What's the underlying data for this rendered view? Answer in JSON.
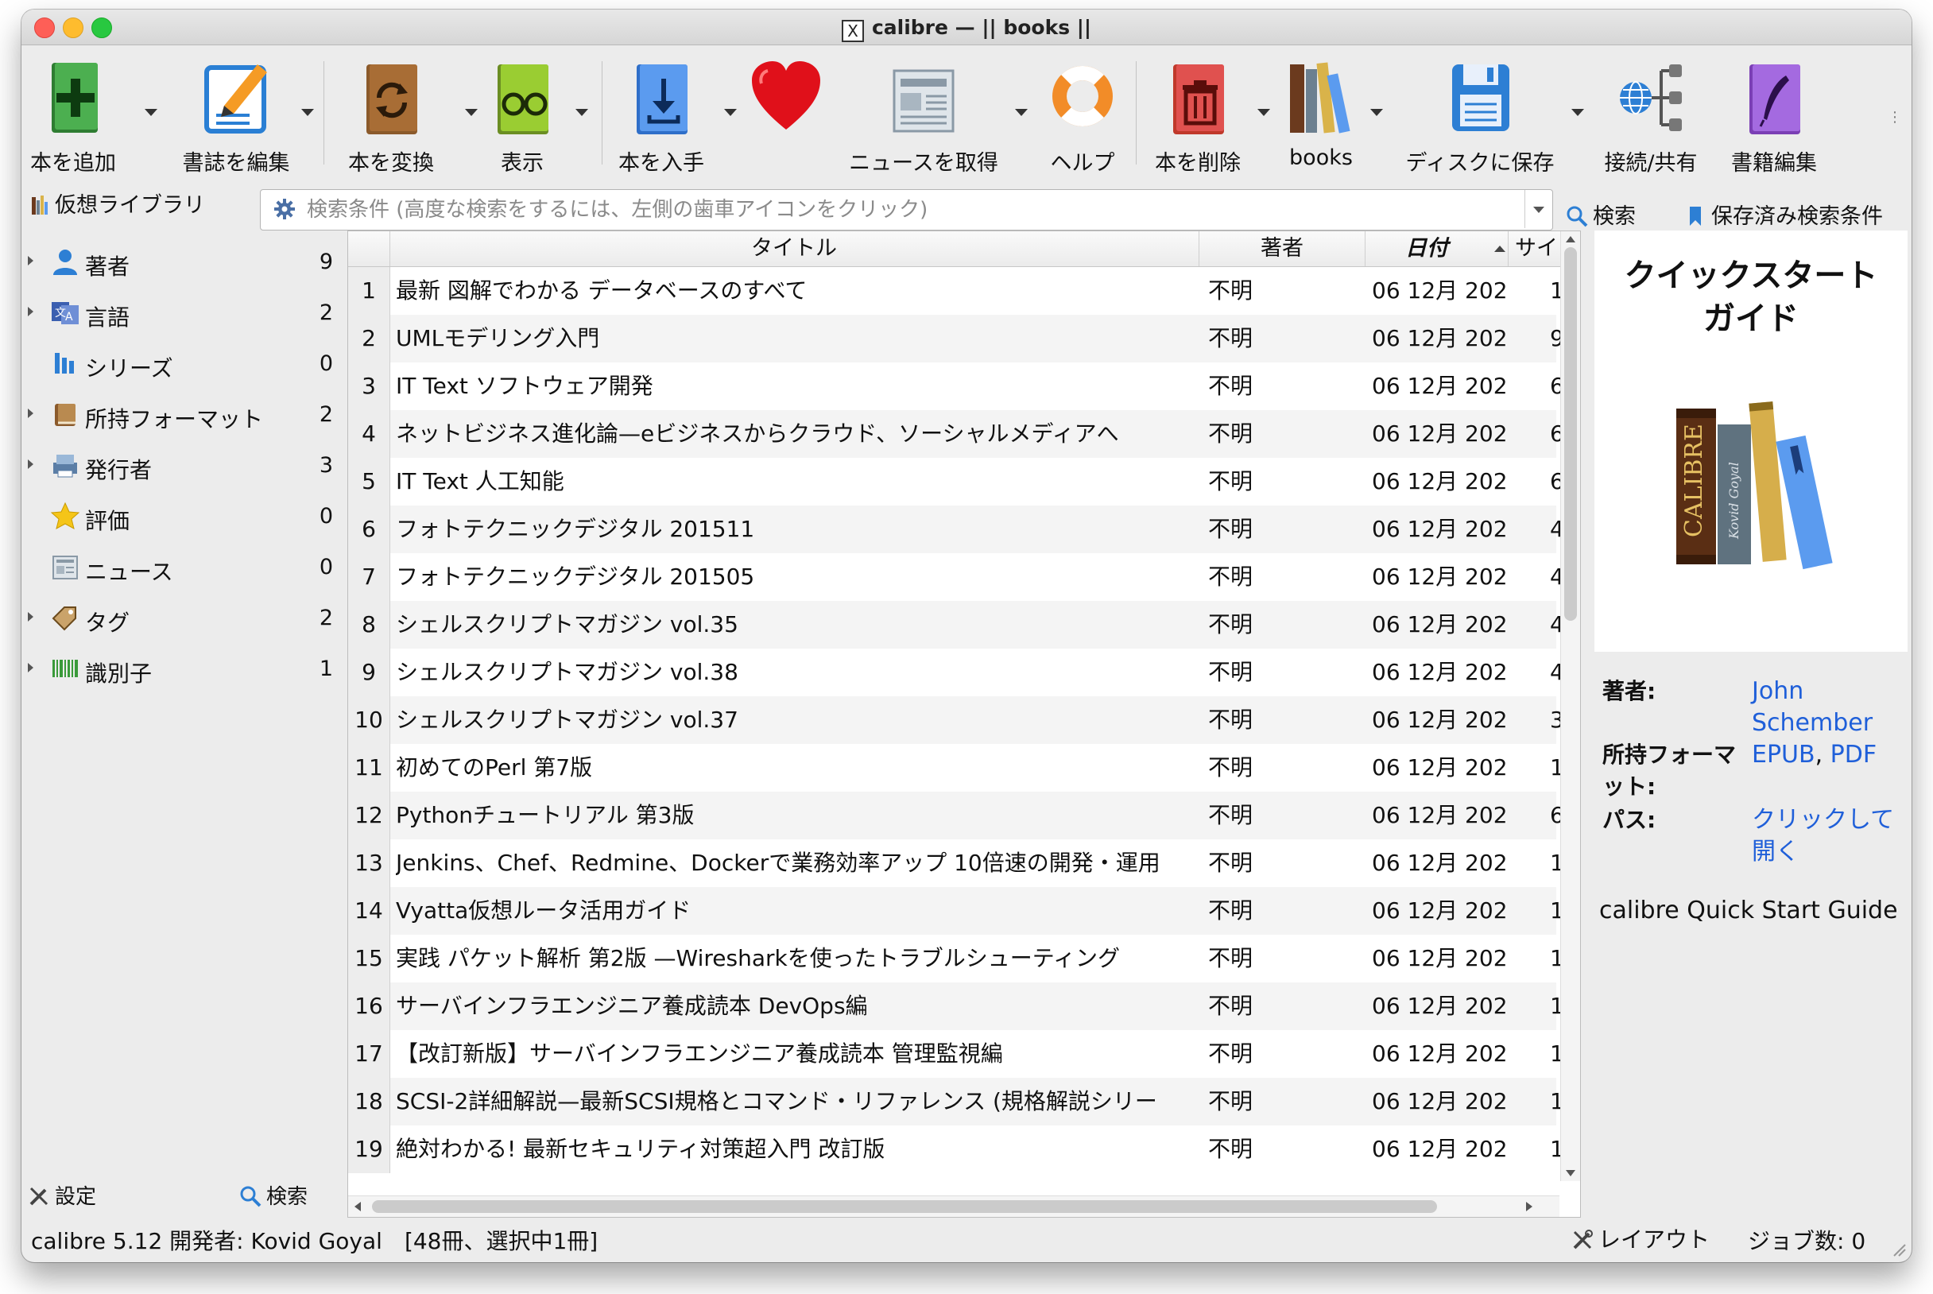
{
  "window": {
    "title": "calibre — || books ||"
  },
  "toolbar": {
    "add_book": "本を追加",
    "edit_metadata": "書誌を編集",
    "convert": "本を変換",
    "view": "表示",
    "get_books": "本を入手",
    "fetch_news": "ニュースを取得",
    "help": "ヘルプ",
    "remove": "本を削除",
    "library": "books",
    "save_to_disk": "ディスクに保存",
    "connect_share": "接続/共有",
    "edit_book": "書籍編集"
  },
  "search": {
    "virtual_library": "仮想ライブラリ",
    "placeholder": "検索条件 (高度な検索をするには、左側の歯車アイコンをクリック)",
    "search_button": "検索",
    "saved_searches": "保存済み検索条件"
  },
  "tag_browser": {
    "items": [
      {
        "label": "著者",
        "count": "9",
        "icon": "person-icon"
      },
      {
        "label": "言語",
        "count": "2",
        "icon": "language-icon"
      },
      {
        "label": "シリーズ",
        "count": "0",
        "icon": "series-icon"
      },
      {
        "label": "所持フォーマット",
        "count": "2",
        "icon": "format-book-icon"
      },
      {
        "label": "発行者",
        "count": "3",
        "icon": "publisher-icon"
      },
      {
        "label": "評価",
        "count": "0",
        "icon": "star-icon"
      },
      {
        "label": "ニュース",
        "count": "0",
        "icon": "news-icon"
      },
      {
        "label": "タグ",
        "count": "2",
        "icon": "tag-icon"
      },
      {
        "label": "識別子",
        "count": "1",
        "icon": "barcode-icon"
      }
    ],
    "settings": "設定",
    "find": "検索"
  },
  "book_list": {
    "columns": {
      "title": "タイトル",
      "author": "著者",
      "date": "日付",
      "size": "サイ"
    },
    "rows": [
      {
        "n": "1",
        "title": "最新 図解でわかる データベースのすべて",
        "author": "不明",
        "date": "06 12月 202",
        "size": "1"
      },
      {
        "n": "2",
        "title": "UMLモデリング入門",
        "author": "不明",
        "date": "06 12月 202",
        "size": "9"
      },
      {
        "n": "3",
        "title": "IT Text ソフトウェア開発",
        "author": "不明",
        "date": "06 12月 202",
        "size": "6"
      },
      {
        "n": "4",
        "title": "ネットビジネス進化論—eビジネスからクラウド、ソーシャルメディアへ",
        "author": "不明",
        "date": "06 12月 202",
        "size": "6"
      },
      {
        "n": "5",
        "title": "IT Text 人工知能",
        "author": "不明",
        "date": "06 12月 202",
        "size": "6"
      },
      {
        "n": "6",
        "title": "フォトテクニックデジタル 201511",
        "author": "不明",
        "date": "06 12月 202",
        "size": "4"
      },
      {
        "n": "7",
        "title": "フォトテクニックデジタル 201505",
        "author": "不明",
        "date": "06 12月 202",
        "size": "4"
      },
      {
        "n": "8",
        "title": "シェルスクリプトマガジン vol.35",
        "author": "不明",
        "date": "06 12月 202",
        "size": "4"
      },
      {
        "n": "9",
        "title": "シェルスクリプトマガジン vol.38",
        "author": "不明",
        "date": "06 12月 202",
        "size": "4"
      },
      {
        "n": "10",
        "title": "シェルスクリプトマガジン vol.37",
        "author": "不明",
        "date": "06 12月 202",
        "size": "3"
      },
      {
        "n": "11",
        "title": "初めてのPerl 第7版",
        "author": "不明",
        "date": "06 12月 202",
        "size": "1"
      },
      {
        "n": "12",
        "title": "Pythonチュートリアル 第3版",
        "author": "不明",
        "date": "06 12月 202",
        "size": "6"
      },
      {
        "n": "13",
        "title": "Jenkins、Chef、Redmine、Dockerで業務効率アップ 10倍速の開発・運用",
        "author": "不明",
        "date": "06 12月 202",
        "size": "1"
      },
      {
        "n": "14",
        "title": "Vyatta仮想ルータ活用ガイド",
        "author": "不明",
        "date": "06 12月 202",
        "size": "1"
      },
      {
        "n": "15",
        "title": "実践 パケット解析 第2版 —Wiresharkを使ったトラブルシューティング",
        "author": "不明",
        "date": "06 12月 202",
        "size": "1"
      },
      {
        "n": "16",
        "title": "サーバインフラエンジニア養成読本 DevOps編",
        "author": "不明",
        "date": "06 12月 202",
        "size": "1"
      },
      {
        "n": "17",
        "title": "【改訂新版】サーバインフラエンジニア養成読本 管理監視編",
        "author": "不明",
        "date": "06 12月 202",
        "size": "1"
      },
      {
        "n": "18",
        "title": "SCSI-2詳細解説—最新SCSI規格とコマンド・リファレンス (規格解説シリー",
        "author": "不明",
        "date": "06 12月 202",
        "size": "1"
      },
      {
        "n": "19",
        "title": "絶対わかる! 最新セキュリティ対策超入門 改訂版",
        "author": "不明",
        "date": "06 12月 202",
        "size": "1"
      }
    ]
  },
  "details": {
    "cover_title": "クイックスタート\nガイド",
    "cover_spine_text": "CALIBRE",
    "cover_spine_author": "Kovid Goyal",
    "author_label": "著者:",
    "author_value": "John Schember",
    "formats_label": "所持フォーマット:",
    "formats_epub": "EPUB",
    "formats_sep": ", ",
    "formats_pdf": "PDF",
    "path_label": "パス:",
    "path_value": "クリックして開く",
    "comment": "calibre Quick Start Guide"
  },
  "status": {
    "left": "calibre 5.12 開発者: Kovid Goyal　[48冊、選択中1冊]",
    "layout": "レイアウト",
    "jobs": "ジョブ数: 0"
  },
  "colors": {
    "link": "#1f5fd9",
    "heart": "#e0101a",
    "add": "#3fa03f",
    "remove": "#e0514f"
  }
}
